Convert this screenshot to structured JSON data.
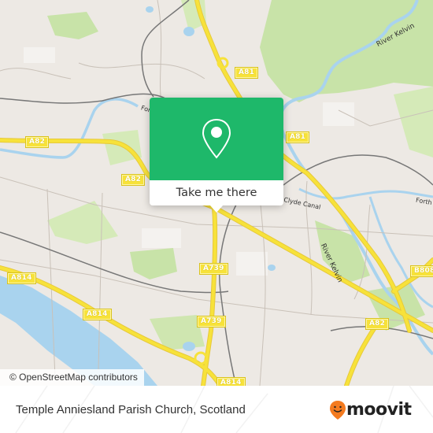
{
  "map": {
    "road_labels": [
      {
        "id": "a82-west",
        "text": "A82"
      },
      {
        "id": "a82-mid",
        "text": "A82"
      },
      {
        "id": "a81-north",
        "text": "A81"
      },
      {
        "id": "a81-mid",
        "text": "A81"
      },
      {
        "id": "a739-north",
        "text": "A739"
      },
      {
        "id": "a739-south",
        "text": "A739"
      },
      {
        "id": "a814-west",
        "text": "A814"
      },
      {
        "id": "a814-mid",
        "text": "A814"
      },
      {
        "id": "a814-south",
        "text": "A814"
      },
      {
        "id": "a82-east",
        "text": "A82"
      },
      {
        "id": "b808",
        "text": "B808"
      }
    ],
    "place_labels": {
      "river_kelvin_north": "River Kelvin",
      "river_kelvin_mid": "River Kelvin",
      "forth_clyde_canal": "Clyde Canal",
      "forth_east": "Forth a",
      "forth_west": "For"
    },
    "attribution": "© OpenStreetMap contributors",
    "colors": {
      "land": "#ede9e4",
      "park": "#c8e3a8",
      "water": "#a9d3ee",
      "road_major": "#f7e23a",
      "rail": "#777777"
    }
  },
  "popup": {
    "icon": "location-pin-icon",
    "button_label": "Take me there",
    "color": "#1eb86a"
  },
  "footer": {
    "place_title": "Temple Anniesland Parish Church, Scotland",
    "brand_name": "moovit",
    "brand_color": "#f47b20"
  }
}
